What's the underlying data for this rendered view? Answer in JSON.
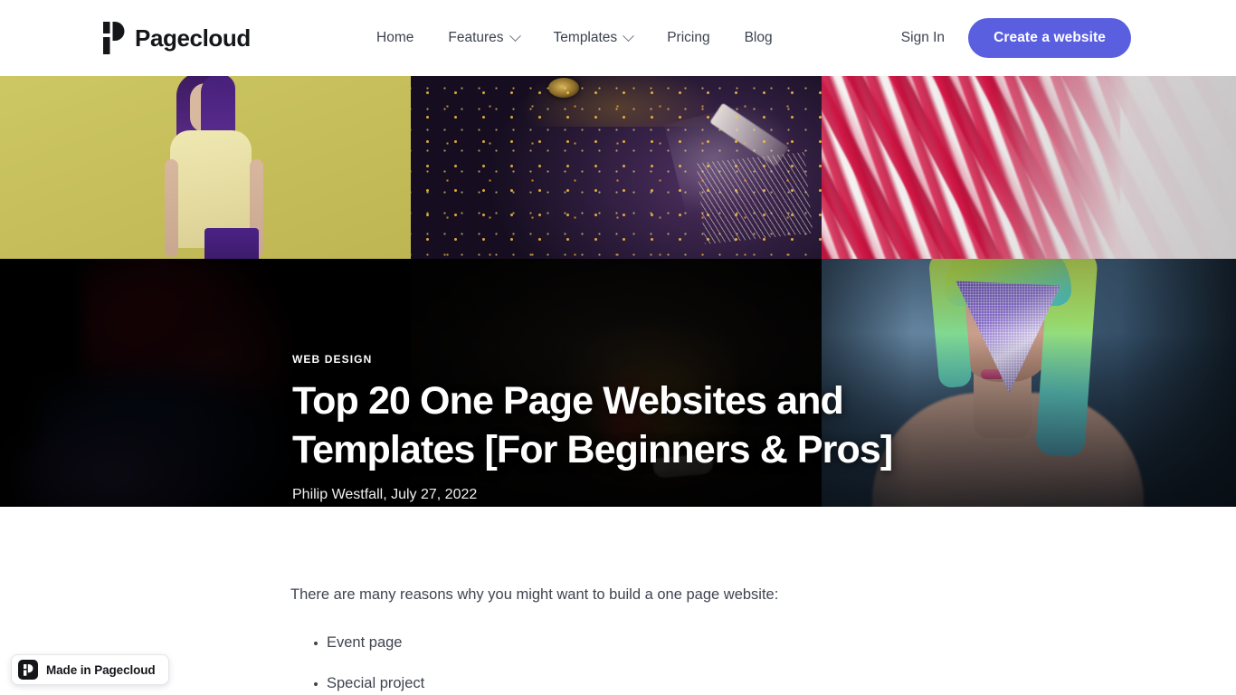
{
  "header": {
    "brand": {
      "name": "Pagecloud",
      "icon": "pagecloud-logo-icon"
    },
    "nav": [
      {
        "label": "Home",
        "has_dropdown": false
      },
      {
        "label": "Features",
        "has_dropdown": true
      },
      {
        "label": "Templates",
        "has_dropdown": true
      },
      {
        "label": "Pricing",
        "has_dropdown": false
      },
      {
        "label": "Blog",
        "has_dropdown": false
      }
    ],
    "sign_in_label": "Sign In",
    "cta_label": "Create a website",
    "cta_color": "#5a5fe0"
  },
  "hero": {
    "kicker": "WEB DESIGN",
    "title": "Top 20 One Page Websites and Templates [For Beginners & Pros]",
    "byline": "Philip Westfall, July 27, 2022",
    "tiles": [
      {
        "name": "yellow-fashion-photo",
        "accent": "#c6bf5b"
      },
      {
        "name": "purple-gold-glitter-face-photo",
        "accent": "#2d1c3c"
      },
      {
        "name": "crimson-paint-strokes-photo",
        "accent": "#cd1242"
      },
      {
        "name": "red-blue-smoke-photo",
        "accent": "#8d0f20"
      },
      {
        "name": "dark-gold-mask-face-photo",
        "accent": "#120f0d"
      },
      {
        "name": "green-hair-mesh-veil-photo",
        "accent": "#44637f"
      }
    ]
  },
  "article": {
    "intro": "There are many reasons why you might want to build a one page website:",
    "bullets": [
      "Event page",
      "Special project"
    ]
  },
  "badge": {
    "label": "Made in Pagecloud",
    "icon": "pagecloud-logo-icon"
  }
}
